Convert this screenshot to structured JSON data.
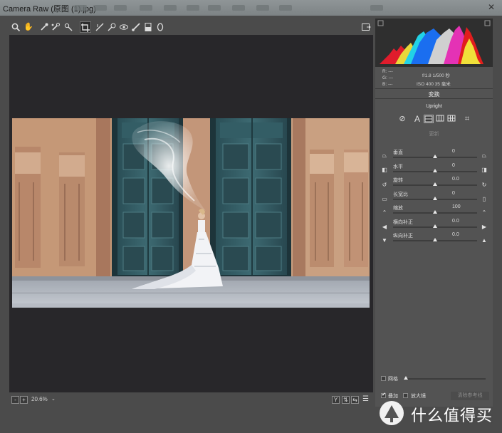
{
  "window": {
    "title": "Camera Raw (原图 (1).jpg)"
  },
  "statusbar": {
    "zoom": "20.6%",
    "minus": "-",
    "plus": "+",
    "view_y": "Y"
  },
  "readout": {
    "r": "R:  ---",
    "g": "G:  ---",
    "b": "B:  ---",
    "exposure": "f/1.8   1/500 秒",
    "iso": "ISO 400   35 毫米"
  },
  "panel": {
    "title": "变换",
    "upright_label": "Upright",
    "update_label": "更新",
    "sliders": [
      {
        "label": "垂直",
        "value": "0",
        "pos": 0.5
      },
      {
        "label": "水平",
        "value": "0",
        "pos": 0.5
      },
      {
        "label": "旋转",
        "value": "0.0",
        "pos": 0.5
      },
      {
        "label": "长宽比",
        "value": "0",
        "pos": 0.5
      },
      {
        "label": "缩放",
        "value": "100",
        "pos": 0.5
      },
      {
        "label": "横向补正",
        "value": "0.0",
        "pos": 0.5
      },
      {
        "label": "纵向补正",
        "value": "0.0",
        "pos": 0.5
      }
    ],
    "grid_label": "网格",
    "loupe_label": "放大镜",
    "overlay_label": "叠加",
    "clear_guides_label": "清除参考线"
  },
  "watermark": {
    "text": "什么值得买"
  }
}
